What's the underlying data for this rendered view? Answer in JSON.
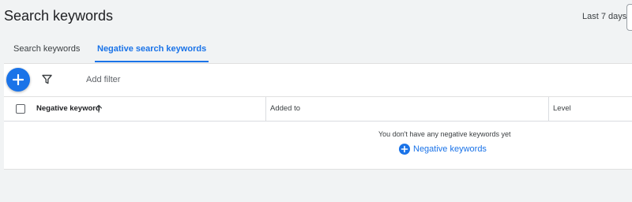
{
  "header": {
    "title": "Search keywords",
    "date_range": "Last 7 days"
  },
  "tabs": [
    {
      "label": "Search keywords",
      "active": false
    },
    {
      "label": "Negative search keywords",
      "active": true
    }
  ],
  "toolbar": {
    "add_icon": "plus-icon",
    "filter_icon": "filter-icon",
    "add_filter_placeholder": "Add filter"
  },
  "table": {
    "columns": [
      {
        "label": "Negative keyword",
        "sort": "ascending"
      },
      {
        "label": "Added to"
      },
      {
        "label": "Level"
      }
    ],
    "rows": []
  },
  "empty_state": {
    "message": "You don't have any negative keywords yet",
    "action_label": "Negative keywords",
    "action_icon": "plus-circle-icon"
  },
  "colors": {
    "accent": "#1a73e8",
    "background": "#f1f3f4",
    "surface": "#ffffff"
  }
}
